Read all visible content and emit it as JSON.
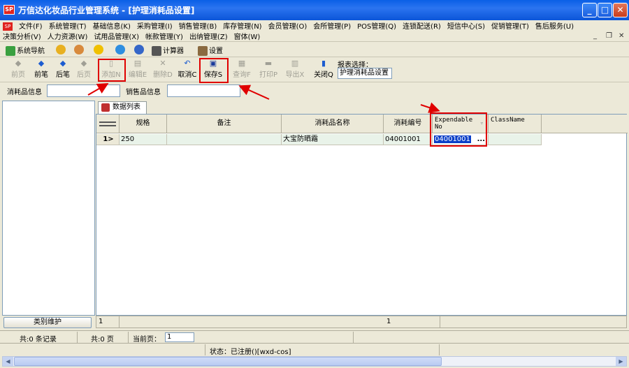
{
  "window": {
    "logo": "SP",
    "title": "万信达化妆品行业管理系统 - [护理消耗品设置]",
    "buttons": {
      "minimize": "_",
      "maximize": "□",
      "close": "✕"
    }
  },
  "menu": {
    "row1": [
      "文件(F)",
      "系统管理(T)",
      "基础信息(K)",
      "采购管理(I)",
      "销售管理(B)",
      "库存管理(N)",
      "会员管理(O)",
      "会所管理(P)",
      "POS管理(Q)",
      "连锁配送(R)",
      "短信中心(S)",
      "促销管理(T)",
      "售后服务(U)"
    ],
    "row2": [
      "决策分析(V)",
      "人力资源(W)",
      "试用品管理(X)",
      "帐款管理(Y)",
      "出纳管理(Z)",
      "窗体(W)"
    ],
    "mdi": {
      "min": "_",
      "restore": "❐",
      "close": "✕"
    }
  },
  "navbar": {
    "nav_label": "系统导航",
    "calc_label": "计算器",
    "settings_label": "设置"
  },
  "toolbar": {
    "first": "前页",
    "prev": "前笔",
    "next": "后笔",
    "last": "后页",
    "add": "添加N",
    "edit": "编辑E",
    "delete": "删除D",
    "cancel": "取消C",
    "save": "保存S",
    "query": "查询F",
    "print": "打印P",
    "export": "导出X",
    "close": "关闭Q",
    "report_label": "报表选择：",
    "report_value": "护理消耗品设置"
  },
  "filter": {
    "label1": "消耗品信息",
    "value1": "",
    "label2": "销售品信息",
    "value2": ""
  },
  "tab": {
    "label": "数据列表"
  },
  "grid": {
    "headers": {
      "spec": "规格",
      "remark": "备注",
      "name": "消耗品名称",
      "code": "消耗编号",
      "exp_no": "Expendable No",
      "classname": "ClassName"
    },
    "row": {
      "indicator": "1>",
      "spec": "250",
      "remark": "",
      "name": "大宝防晒霜",
      "code": "04001001",
      "exp_no": "04001001",
      "classname": "",
      "ellipsis": "..."
    },
    "footer": {
      "left": "1",
      "code": "1"
    }
  },
  "left": {
    "category_button": "类别维护"
  },
  "status": {
    "records": "共:0 条记录",
    "pages": "共:0 页",
    "current_label": "当前页：",
    "current_value": "1",
    "info": "状态：已注册()[wxd-cos]"
  },
  "colors": {
    "titlebar": "#0a5fe6",
    "highlight": "#e00000",
    "selection": "#0a3fc8"
  }
}
